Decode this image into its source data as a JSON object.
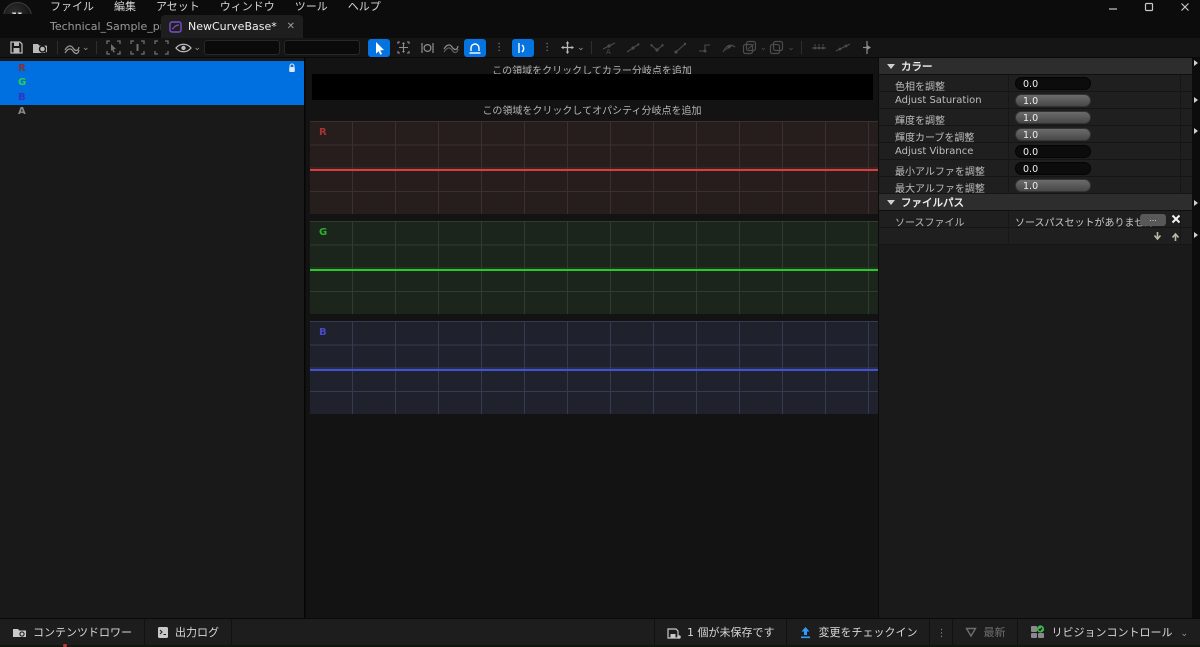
{
  "menu": {
    "items": [
      "ファイル",
      "編集",
      "アセット",
      "ウィンドウ",
      "ツール",
      "ヘルプ"
    ]
  },
  "tabs": [
    {
      "label": "Technical_Sample_proje...",
      "active": false
    },
    {
      "label": "NewCurveBase*",
      "active": true
    }
  ],
  "channels": [
    {
      "label": "R",
      "selected": true,
      "color": "#8c2f2f"
    },
    {
      "label": "G",
      "selected": true,
      "color": "#2fd04a"
    },
    {
      "label": "B",
      "selected": true,
      "color": "#3333bb"
    },
    {
      "label": "A",
      "selected": false,
      "color": "#8a8a8a"
    }
  ],
  "curve_editor": {
    "color_hint": "この領域をクリックしてカラー分岐点を追加",
    "opacity_hint": "この領域をクリックしてオパシティ分岐点を追加",
    "tracks": [
      {
        "label": "R",
        "line_color": "#e13b3b"
      },
      {
        "label": "G",
        "line_color": "#24cc24"
      },
      {
        "label": "B",
        "line_color": "#4053d6"
      }
    ]
  },
  "details": {
    "sections": [
      {
        "title": "カラー",
        "rows": [
          {
            "label": "色相を調整",
            "value": "0.0"
          },
          {
            "label": "Adjust Saturation",
            "value": "1.0"
          },
          {
            "label": "輝度を調整",
            "value": "1.0"
          },
          {
            "label": "輝度カーブを調整",
            "value": "1.0"
          },
          {
            "label": "Adjust Vibrance",
            "value": "0.0"
          },
          {
            "label": "最小アルファを調整",
            "value": "0.0"
          },
          {
            "label": "最大アルファを調整",
            "value": "1.0"
          }
        ]
      },
      {
        "title": "ファイルパス",
        "rows": [
          {
            "label": "ソースファイル",
            "value": "ソースパスセットがありません",
            "browse_label": "..."
          }
        ]
      }
    ]
  },
  "statusbar": {
    "content_drawer": "コンテンツドロワー",
    "output_log": "出力ログ",
    "unsaved": "1 個が未保存です",
    "checkin": "変更をチェックイン",
    "latest": "最新",
    "revision_control": "リビジョンコントロール"
  },
  "colors": {
    "selection_blue": "#0070e0",
    "toolbar_active_blue": "#0573e0",
    "checkin_arrow_blue": "#2e9bff",
    "revision_green": "#3fb950",
    "warning_orange": "#d79022",
    "curve_asset_purple": "#7a4fd0"
  }
}
